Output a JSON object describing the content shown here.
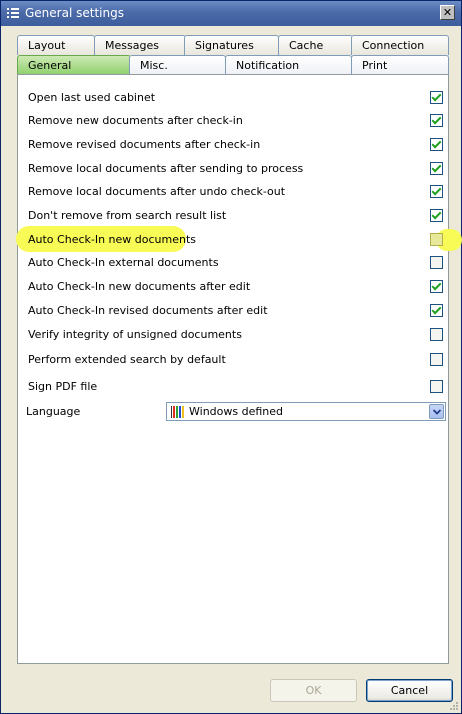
{
  "window": {
    "title": "General settings"
  },
  "tabs": {
    "row1": [
      "Layout",
      "Messages",
      "Signatures",
      "Cache",
      "Connection"
    ],
    "row2": [
      "General",
      "Misc.",
      "Notification",
      "Print"
    ],
    "active": "General"
  },
  "options": [
    {
      "label": "Open last used cabinet",
      "checked": true
    },
    {
      "label": "Remove new documents after check-in",
      "checked": true
    },
    {
      "label": "Remove revised documents after check-in",
      "checked": true
    },
    {
      "label": "Remove local documents after sending to process",
      "checked": true
    },
    {
      "label": "Remove local documents after undo check-out",
      "checked": true
    },
    {
      "label": "Don't remove from search result list",
      "checked": true
    },
    {
      "label": "Auto Check-In new documents",
      "checked": false,
      "highlighted": true
    },
    {
      "label": "Auto Check-In external documents",
      "checked": false
    },
    {
      "label": "Auto Check-In new documents after edit",
      "checked": true
    },
    {
      "label": "Auto Check-In revised documents after edit",
      "checked": true
    },
    {
      "label": "Verify integrity of unsigned documents",
      "checked": false
    },
    {
      "label": "Perform extended search by default",
      "checked": false
    },
    {
      "label": "Sign PDF file",
      "checked": false
    }
  ],
  "language": {
    "label": "Language",
    "value": "Windows defined"
  },
  "buttons": {
    "ok": "OK",
    "cancel": "Cancel"
  },
  "colors": {
    "highlight": "#f8fb55",
    "active_tab": "#8ed06c",
    "titlebar": "#4a6aa8"
  }
}
